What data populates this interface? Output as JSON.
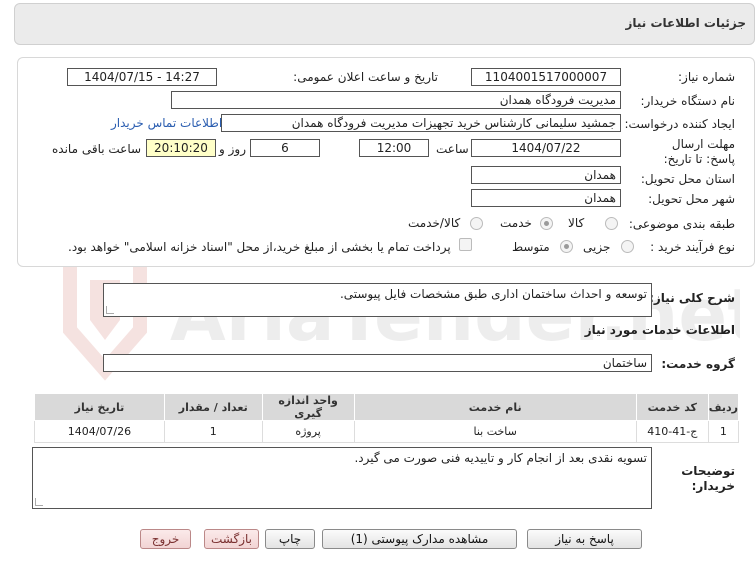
{
  "header": {
    "title": "جزئیات اطلاعات نیاز"
  },
  "form": {
    "need_number_label": "شماره نیاز:",
    "need_number": "1104001517000007",
    "announce_label": "تاریخ و ساعت اعلان عمومی:",
    "announce_value": "1404/07/15 - 14:27",
    "buyer_org_label": "نام دستگاه خریدار:",
    "buyer_org": "مدیریت فرودگاه همدان",
    "creator_label": "ایجاد کننده درخواست:",
    "creator": "جمشید سلیمانی کارشناس خرید تجهیزات مدیریت فرودگاه همدان",
    "contact_link": "اطلاعات تماس خریدار",
    "deadline_label": "مهلت ارسال پاسخ: تا تاریخ:",
    "deadline_date": "1404/07/22",
    "time_label": "ساعت",
    "deadline_time": "12:00",
    "days_value": "6",
    "days_label": "روز و",
    "remaining_time": "20:10:20",
    "remaining_label": "ساعت باقی مانده",
    "province_label": "استان محل تحویل:",
    "province": "همدان",
    "city_label": "شهر محل تحویل:",
    "city": "همدان",
    "category_label": "طبقه بندی موضوعی:",
    "category_options": [
      "کالا",
      "خدمت",
      "کالا/خدمت"
    ],
    "process_label": "نوع فرآیند خرید :",
    "process_options": [
      "جزیی",
      "متوسط"
    ],
    "payment_note": "پرداخت تمام یا بخشی از مبلغ خرید،از محل \"اسناد خزانه اسلامی\" خواهد بود."
  },
  "description": {
    "label": "شرح کلی نیاز:",
    "value": "توسعه و احداث ساختمان اداری طبق مشخصات فایل پیوستی."
  },
  "services": {
    "section_title": "اطلاعات خدمات مورد نیاز",
    "group_label": "گروه خدمت:",
    "group_value": "ساختمان",
    "table": {
      "headers": [
        "ردیف",
        "کد خدمت",
        "نام خدمت",
        "واحد اندازه گیری",
        "تعداد / مقدار",
        "تاریخ نیاز"
      ],
      "rows": [
        [
          "1",
          "ج-41-410",
          "ساخت بنا",
          "پروژه",
          "1",
          "1404/07/26"
        ]
      ]
    }
  },
  "buyer_notes": {
    "label": "توضیحات خریدار:",
    "value": "تسویه نقدی بعد از انجام کار و تاییدیه فنی صورت می گیرد."
  },
  "buttons": {
    "reply": "پاسخ به نیاز",
    "attachments": "مشاهده مدارک پیوستی (1)",
    "print": "چاپ",
    "back": "بازگشت",
    "exit": "خروج"
  },
  "watermark": {
    "text": "AriaTender.net"
  },
  "colors": {
    "link": "#2a5db0",
    "remaining_bg": "#ffffc8",
    "exit_button": "#f2d4d4"
  }
}
